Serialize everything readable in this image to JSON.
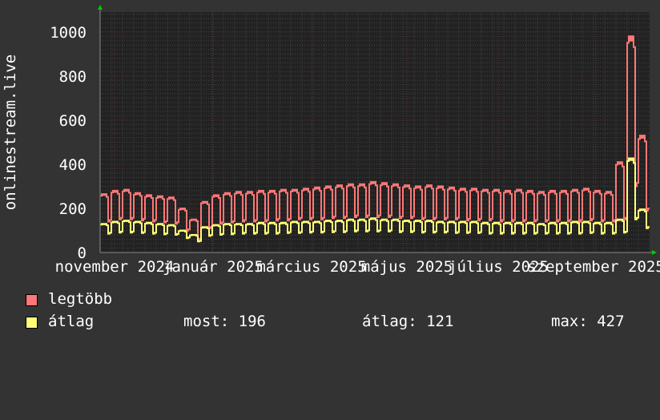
{
  "chart_data": {
    "type": "line",
    "ylabel": "onlinestream.live",
    "ylim": [
      0,
      1090
    ],
    "yticks": [
      0,
      200,
      400,
      600,
      800,
      1000
    ],
    "xtick_labels": [
      "november 2024",
      "január 2025",
      "március 2025",
      "május 2025",
      "július 2025",
      "szeptember 2025"
    ],
    "grid": true,
    "granularity": "weekly pattern: 5 high days then 2 low days",
    "series": [
      {
        "name": "legtöbb",
        "color": "#ff7777",
        "week_peaks": [
          265,
          280,
          285,
          270,
          260,
          255,
          250,
          200,
          150,
          230,
          260,
          270,
          275,
          275,
          280,
          280,
          285,
          285,
          290,
          295,
          300,
          305,
          310,
          310,
          320,
          315,
          310,
          305,
          300,
          305,
          300,
          295,
          290,
          290,
          285,
          285,
          280,
          285,
          280,
          275,
          280,
          280,
          285,
          290,
          280,
          275,
          410,
          980,
          530
        ],
        "week_dips": [
          140,
          150,
          150,
          145,
          140,
          135,
          130,
          100,
          60,
          110,
          130,
          135,
          140,
          140,
          140,
          145,
          145,
          150,
          150,
          150,
          155,
          155,
          160,
          160,
          160,
          160,
          155,
          155,
          150,
          150,
          150,
          150,
          145,
          145,
          145,
          140,
          140,
          140,
          140,
          140,
          140,
          140,
          140,
          145,
          140,
          140,
          150,
          300,
          190
        ]
      },
      {
        "name": "átlag",
        "color": "#ffff77",
        "week_peaks": [
          130,
          140,
          145,
          140,
          135,
          130,
          125,
          100,
          80,
          115,
          125,
          130,
          130,
          130,
          135,
          135,
          135,
          140,
          140,
          140,
          145,
          145,
          150,
          150,
          155,
          150,
          150,
          145,
          145,
          145,
          140,
          140,
          140,
          140,
          135,
          135,
          135,
          135,
          135,
          130,
          135,
          135,
          140,
          140,
          135,
          135,
          150,
          427,
          196
        ],
        "week_dips": [
          85,
          90,
          90,
          88,
          85,
          82,
          80,
          65,
          50,
          75,
          80,
          82,
          85,
          85,
          85,
          85,
          88,
          88,
          90,
          90,
          92,
          92,
          95,
          95,
          95,
          95,
          92,
          92,
          90,
          90,
          90,
          88,
          88,
          88,
          85,
          85,
          85,
          85,
          85,
          85,
          85,
          85,
          85,
          88,
          85,
          85,
          90,
          150,
          110
        ]
      }
    ]
  },
  "legend": {
    "items": [
      {
        "label": "legtöbb",
        "color": "#ff7777"
      },
      {
        "label": "átlag",
        "color": "#ffff77"
      }
    ],
    "stats": {
      "now": "most: 196",
      "avg": "átlag: 121",
      "max": "max: 427"
    }
  }
}
